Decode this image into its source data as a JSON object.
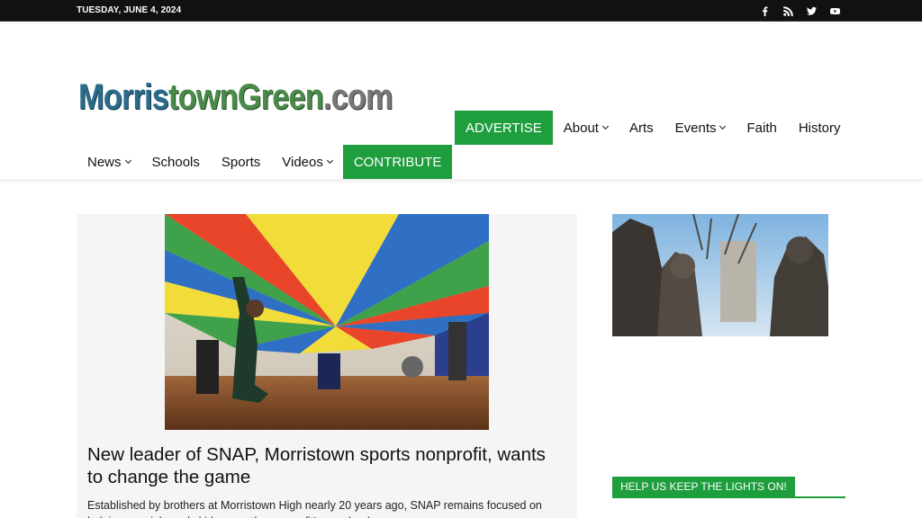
{
  "topbar": {
    "date": "TUESDAY, JUNE 4, 2024",
    "social_icons": [
      "facebook-icon",
      "rss-icon",
      "twitter-icon",
      "youtube-icon"
    ]
  },
  "logo": {
    "part1": "Morris",
    "part2": "townGreen",
    "part3": ".com"
  },
  "nav": {
    "advertise": "ADVERTISE",
    "about": "About",
    "arts": "Arts",
    "events": "Events",
    "faith": "Faith",
    "history": "History",
    "news": "News",
    "schools": "Schools",
    "sports": "Sports",
    "videos": "Videos",
    "contribute": "CONTRIBUTE"
  },
  "featured": {
    "title": "New leader of SNAP, Morristown sports nonprofit, wants to change the game",
    "excerpt": "Established by brothers at Morristown High nearly 20 years ago, SNAP remains focused on helping special needs kids, says the nonprofit's new leader."
  },
  "sidebar": {
    "help_label": "HELP US KEEP THE LIGHTS ON!"
  },
  "colors": {
    "accent_green": "#1f9e3e",
    "topbar": "#111111"
  }
}
